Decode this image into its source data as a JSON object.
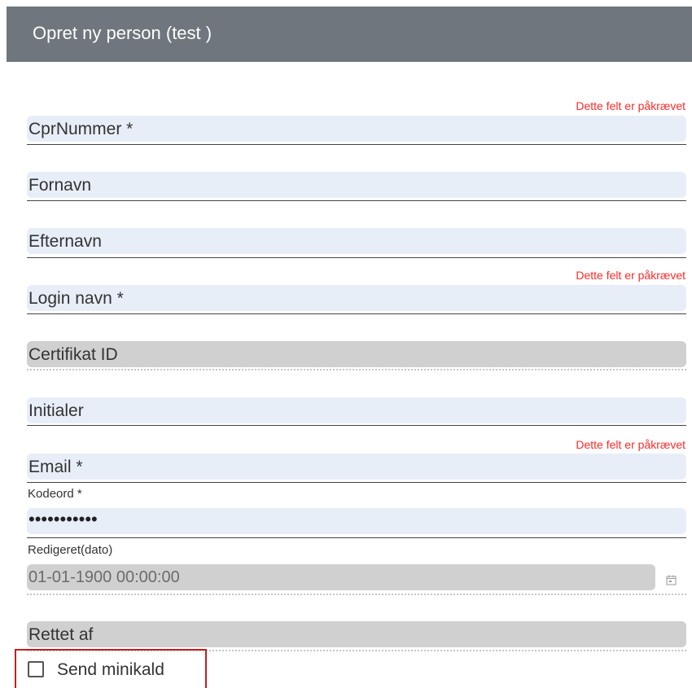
{
  "header": {
    "title": "Opret ny person (test )"
  },
  "required_message": "Dette felt er påkrævet",
  "fields": {
    "cpr": {
      "label": "CprNummer *"
    },
    "fornavn": {
      "label": "Fornavn"
    },
    "efternavn": {
      "label": "Efternavn"
    },
    "login": {
      "label": "Login navn *"
    },
    "certifikat": {
      "label": "Certifikat ID"
    },
    "initialer": {
      "label": "Initialer"
    },
    "email": {
      "label": "Email *"
    },
    "kodeord": {
      "label": "Kodeord *",
      "value": "•••••••••••"
    },
    "redigeret": {
      "label": "Redigeret(dato)",
      "value": "01-01-1900 00:00:00"
    },
    "rettet_af": {
      "label": "Rettet af"
    }
  },
  "send_minikald": {
    "label": "Send minikald",
    "checked": false
  }
}
